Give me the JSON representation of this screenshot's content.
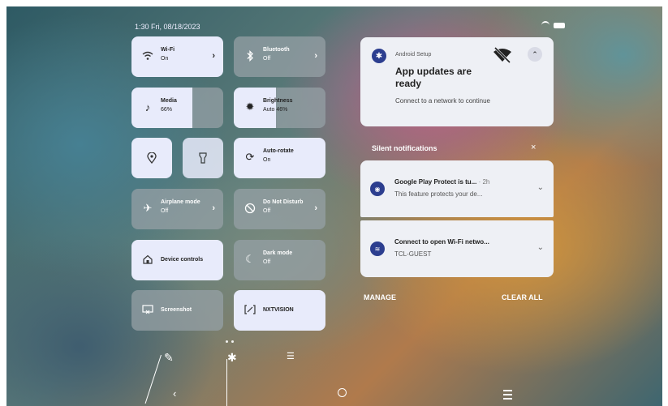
{
  "status": {
    "datetime": "1:30 Fri, 08/18/2023",
    "icons": [
      "wifi-icon",
      "battery-icon"
    ]
  },
  "tiles": {
    "wifi": {
      "label": "Wi-Fi",
      "state": "On",
      "icon": "wifi-icon",
      "active": true
    },
    "bluetooth": {
      "label": "Bluetooth",
      "state": "Off",
      "icon": "bluetooth-icon",
      "active": false
    },
    "media": {
      "label": "Media",
      "state": "66%",
      "icon": "music-note-icon",
      "level": 0.66
    },
    "brightness": {
      "label": "Brightness",
      "state": "Auto 46%",
      "icon": "brightness-icon",
      "level": 0.46
    },
    "location": {
      "icon": "location-icon",
      "active": true
    },
    "flashlight": {
      "icon": "flashlight-icon",
      "active": true
    },
    "autorotate": {
      "label": "Auto-rotate",
      "state": "On",
      "icon": "rotate-icon",
      "active": true
    },
    "airplane": {
      "label": "Airplane mode",
      "state": "Off",
      "icon": "airplane-icon",
      "active": false
    },
    "dnd": {
      "label": "Do Not Disturb",
      "state": "Off",
      "icon": "do-not-disturb-icon",
      "active": false
    },
    "device_controls": {
      "label": "Device controls",
      "icon": "home-icon",
      "active": true
    },
    "dark_mode": {
      "label": "Dark mode",
      "state": "Off",
      "icon": "moon-icon",
      "active": false
    },
    "screenshot": {
      "label": "Screenshot",
      "icon": "screenshot-icon",
      "active": false
    },
    "nxtvision": {
      "label": "NXTVISION",
      "icon": "nxtvision-icon",
      "active": true
    }
  },
  "qs_footer": {
    "icons": [
      "edit-icon",
      "settings-icon",
      "media-output-icon"
    ]
  },
  "notifications": {
    "setup": {
      "app": "Android Setup",
      "title": "App updates are ready",
      "body": "Connect to a network to continue"
    },
    "silent_header": "Silent notifications",
    "silent_close": "×",
    "items": [
      {
        "title": "Google Play Protect is tu...",
        "time": "· 2h",
        "body": "This feature protects your de...",
        "icon": "shield-icon"
      },
      {
        "title": "Connect to open Wi-Fi netwo...",
        "time": "",
        "body": "TCL-GUEST",
        "icon": "wifi-icon"
      }
    ],
    "manage": "MANAGE",
    "clear_all": "CLEAR ALL"
  },
  "navbar": {
    "icons": [
      "back-icon",
      "home-icon",
      "recents-icon"
    ]
  },
  "colors": {
    "tile_on": "#e8ebfb",
    "tile_off": "#96a0a5",
    "accent": "#2c3e8f"
  }
}
